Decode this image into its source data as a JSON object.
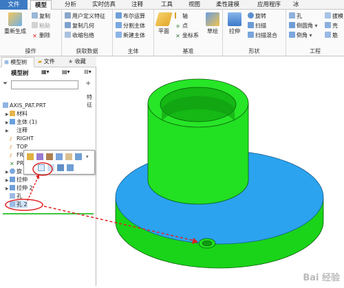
{
  "menubar": {
    "items": [
      "文件",
      "模型",
      "分析",
      "实时仿真",
      "注释",
      "工具",
      "视图",
      "柔性建模",
      "应用程序",
      "冰"
    ],
    "active": "模型"
  },
  "ribbon": {
    "ops": {
      "regen": "重新生成",
      "copy": "复制",
      "paste": "粘贴",
      "delete": "删除",
      "title": "操作"
    },
    "getdata": {
      "udf": "用户定义特征",
      "copygeom": "复制几何",
      "shrinkwrap": "收缩包络",
      "title": "获取数据"
    },
    "body": {
      "boolean": "布尔运算",
      "split": "分割主体",
      "newbody": "新建主体",
      "title": "主体"
    },
    "datum": {
      "plane": "平面",
      "axis": "轴",
      "point": "点",
      "csys": "坐标系",
      "sketch": "草绘",
      "title": "基准"
    },
    "shapes": {
      "extrude": "拉伸",
      "revolve": "旋转",
      "sweep": "扫描",
      "blend": "扫描混合",
      "title": "形状"
    },
    "eng": {
      "hole": "孔",
      "round": "倒圆角",
      "chamfer": "倒角",
      "draft": "拔模",
      "shell": "壳",
      "rib": "筋",
      "title": "工程"
    }
  },
  "sidebar": {
    "tabs": [
      "模型树",
      "文件",
      "收藏"
    ],
    "tree_label": "模型树",
    "filter_placeholder": "",
    "special_label": "特征",
    "nodes": [
      {
        "label": "AXIS_PAT.PRT",
        "type": "part"
      },
      {
        "label": "材料",
        "type": "material"
      },
      {
        "label": "主体 (1)",
        "type": "body"
      },
      {
        "label": "注释",
        "type": "note"
      },
      {
        "label": "RIGHT",
        "type": "plane"
      },
      {
        "label": "TOP",
        "type": "plane"
      },
      {
        "label": "FRO",
        "type": "plane"
      },
      {
        "label": "PRT",
        "type": "csys"
      },
      {
        "label": "旋",
        "type": "feature"
      },
      {
        "label": "拉伸",
        "type": "feature"
      },
      {
        "label": "拉伸 2",
        "type": "feature"
      },
      {
        "label": "孔",
        "type": "hole"
      },
      {
        "label": "孔 2",
        "type": "hole"
      }
    ]
  },
  "colors": {
    "accent": "#3c7bc4",
    "model_green": "#22e022",
    "model_blue": "#2ba3ee",
    "annotation_red": "#e02020"
  },
  "watermark": "Bai 经验"
}
